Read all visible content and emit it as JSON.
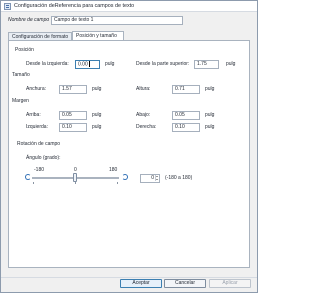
{
  "window": {
    "title": "Configuración deReferencia para campos de texto"
  },
  "field_name": {
    "label": "Nombre de campo",
    "value": "Campo de texto 1"
  },
  "tabs": [
    {
      "label": "Configuración de formato",
      "active": false
    },
    {
      "label": "Posición y tamaño",
      "active": true
    }
  ],
  "position": {
    "heading": "Posición",
    "left_label": "Desde la izquierda:",
    "left_value": "0.00",
    "left_unit": "pulg",
    "top_label": "Desde la parte superior:",
    "top_value": "1.75",
    "top_unit": "pulg"
  },
  "size": {
    "heading": "Tamaño",
    "width_label": "Anchura:",
    "width_value": "1.57",
    "width_unit": "pulg",
    "height_label": "Altura:",
    "height_value": "0.71",
    "height_unit": "pulg"
  },
  "margin": {
    "heading": "Margen",
    "top_label": "Arriba:",
    "top_value": "0.05",
    "top_unit": "pulg",
    "bottom_label": "Abajo:",
    "bottom_value": "0.05",
    "bottom_unit": "pulg",
    "left_label": "Izquierda:",
    "left_value": "0.10",
    "left_unit": "pulg",
    "right_label": "Derecha:",
    "right_value": "0.10",
    "right_unit": "pulg"
  },
  "rotation": {
    "heading": "Rotación de campo",
    "angle_label": "Ángulo (grado):",
    "min_label": "-180",
    "mid_label": "0",
    "max_label": "180",
    "slider_value": 0,
    "spin_value": "0",
    "range_label": "(-180 a 180)"
  },
  "footer": {
    "accept": "Aceptar",
    "cancel": "Cancelar",
    "apply": "Aplicar"
  },
  "colors": {
    "accent": "#3c7fb1",
    "window_bg": "#f0f0f0",
    "panel_bg": "#ffffff"
  }
}
